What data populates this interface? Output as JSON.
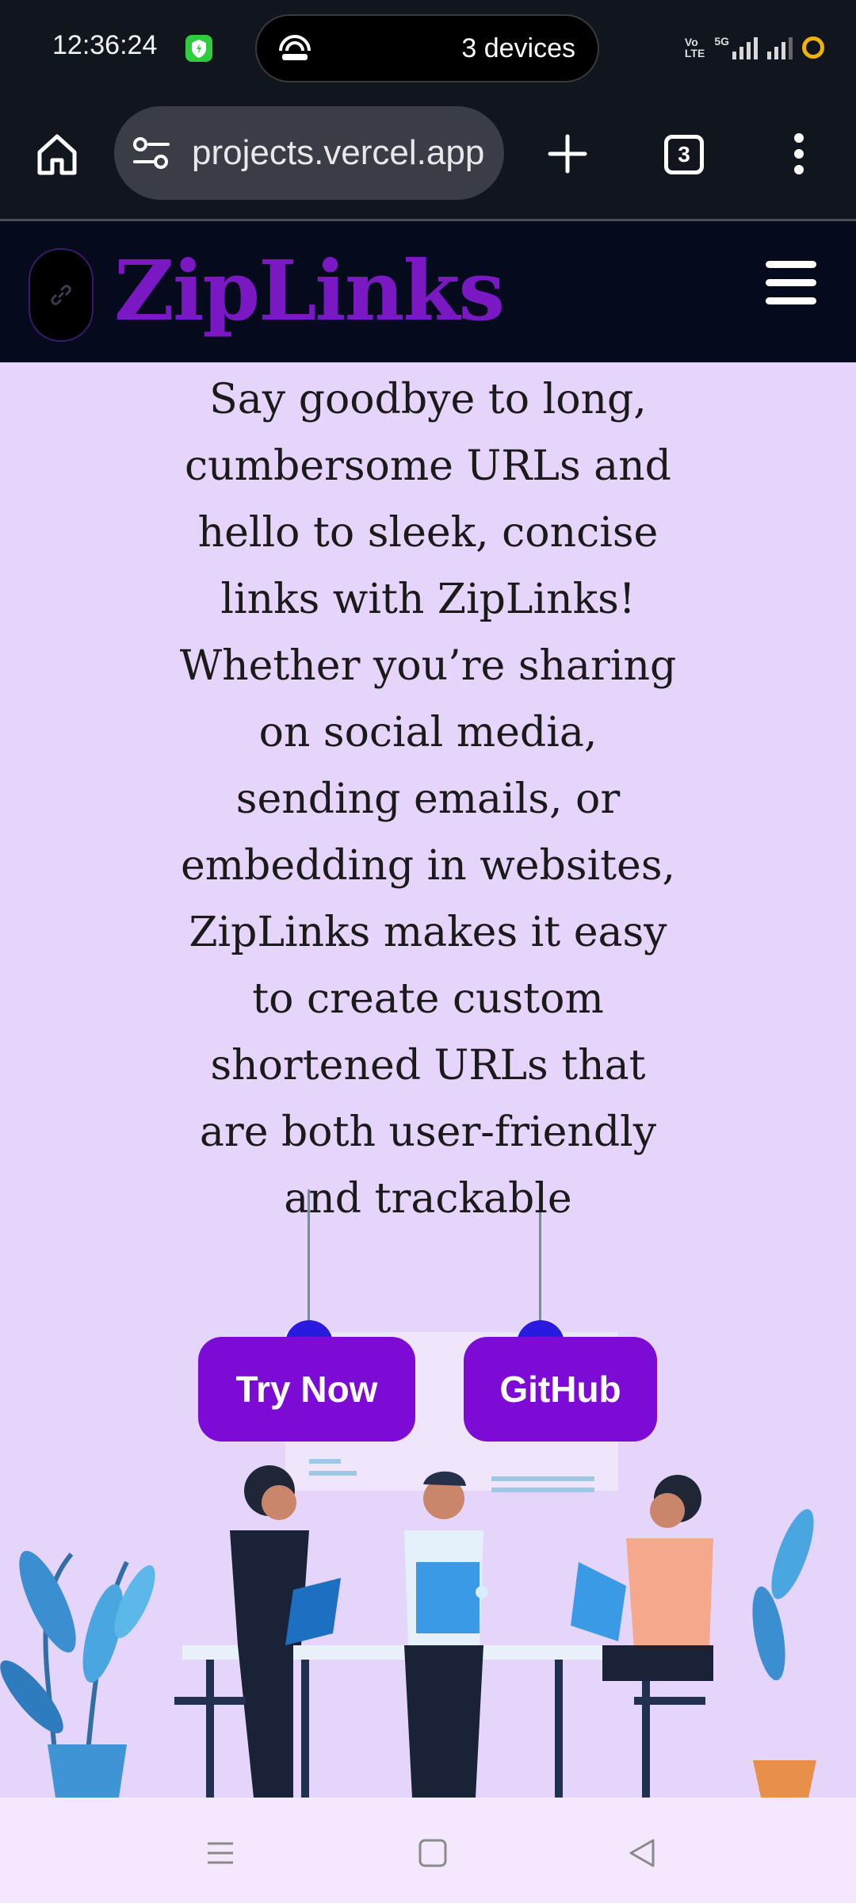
{
  "status_bar": {
    "time": "12:36:24",
    "devices_label": "3 devices",
    "net_label_top": "Vo",
    "net_label_bottom": "LTE",
    "net_5g": "5G"
  },
  "browser": {
    "url_text": "projects.vercel.app",
    "tab_count": "3"
  },
  "site": {
    "brand": "ZipLinks",
    "hero_text": "Say goodbye to long, cumbersome URLs and hello to sleek, concise links with ZipLinks! Whether you’re sharing on social media, sending emails, or embedding in websites, ZipLinks makes it easy to create custom shortened URLs that are both user-friendly and trackable",
    "buttons": {
      "try_now": "Try Now",
      "github": "GitHub"
    }
  },
  "colors": {
    "accent": "#7d0bd6",
    "brand": "#7a18c4",
    "page_bg": "#e6d5fb",
    "header_bg": "#050a1c"
  }
}
